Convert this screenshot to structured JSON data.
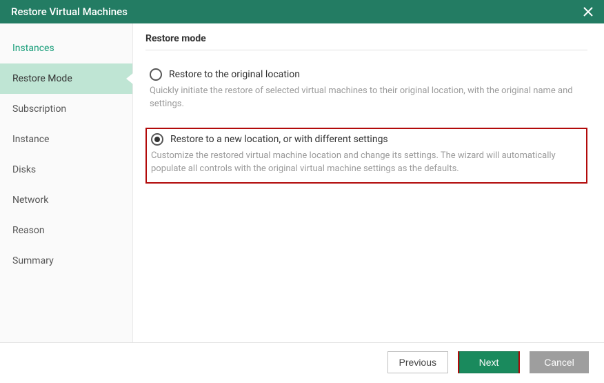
{
  "titlebar": {
    "title": "Restore Virtual Machines"
  },
  "sidebar": {
    "items": [
      {
        "label": "Instances"
      },
      {
        "label": "Restore Mode"
      },
      {
        "label": "Subscription"
      },
      {
        "label": "Instance"
      },
      {
        "label": "Disks"
      },
      {
        "label": "Network"
      },
      {
        "label": "Reason"
      },
      {
        "label": "Summary"
      }
    ]
  },
  "main": {
    "heading": "Restore mode",
    "options": [
      {
        "label": "Restore to the original location",
        "desc": "Quickly initiate the restore of selected virtual machines to their original location, with the original name and settings."
      },
      {
        "label": "Restore to a new location, or with different settings",
        "desc": "Customize the restored virtual machine location and change its settings. The wizard will automatically populate all controls with the original virtual machine settings as the defaults."
      }
    ]
  },
  "footer": {
    "previous": "Previous",
    "next": "Next",
    "cancel": "Cancel"
  }
}
